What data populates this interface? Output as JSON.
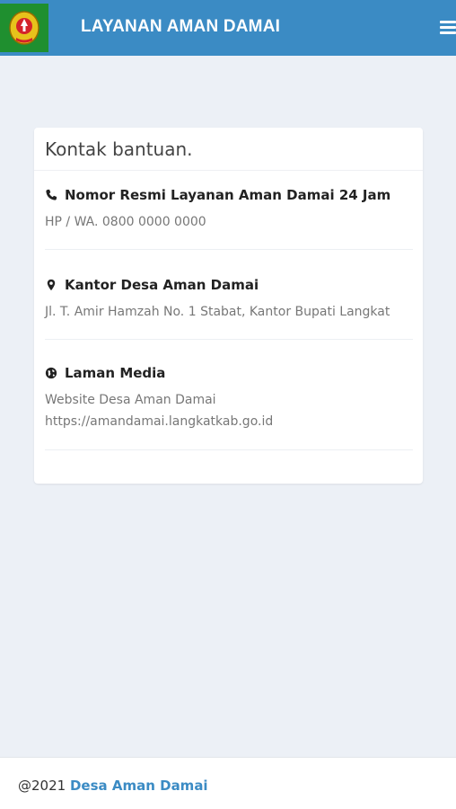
{
  "header": {
    "title": "LAYANAN AMAN DAMAI",
    "logo": "regency-emblem-icon",
    "menu_icon": "hamburger-menu-icon",
    "colors": {
      "header_bg": "#3b8bc4",
      "logo_bg": "#1f8f2f"
    }
  },
  "card": {
    "title": "Kontak bantuan.",
    "items": [
      {
        "icon": "phone-icon",
        "heading": "Nomor Resmi Layanan Aman Damai 24 Jam",
        "lines": [
          "HP / WA. 0800 0000 0000"
        ]
      },
      {
        "icon": "map-marker-icon",
        "heading": "Kantor Desa Aman Damai",
        "lines": [
          "Jl. T. Amir Hamzah No. 1 Stabat, Kantor Bupati Langkat"
        ]
      },
      {
        "icon": "globe-icon",
        "heading": "Laman Media",
        "lines": [
          "Website Desa Aman Damai",
          "https://amandamai.langkatkab.go.id"
        ]
      }
    ]
  },
  "footer": {
    "prefix": "@2021 ",
    "link": "Desa Aman Damai",
    "link_color": "#3b8bc4"
  }
}
